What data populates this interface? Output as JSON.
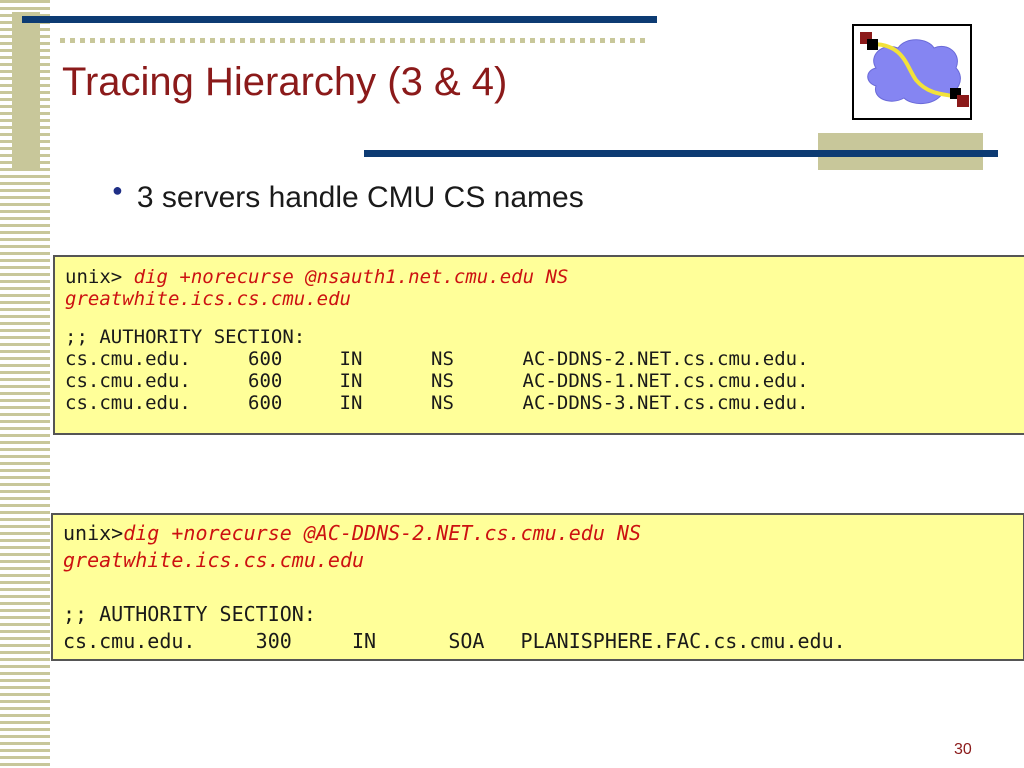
{
  "slide": {
    "title": "Tracing Hierarchy (3 & 4)",
    "bullet": "3 servers handle CMU CS names",
    "page_number": "30"
  },
  "box1": {
    "prompt": "unix> ",
    "command_line1": "dig +norecurse @nsauth1.net.cmu.edu NS",
    "command_line2": "greatwhite.ics.cs.cmu.edu",
    "section_header": ";; AUTHORITY SECTION:",
    "records": [
      "cs.cmu.edu.     600     IN      NS      AC-DDNS-2.NET.cs.cmu.edu.",
      "cs.cmu.edu.     600     IN      NS      AC-DDNS-1.NET.cs.cmu.edu.",
      "cs.cmu.edu.     600     IN      NS      AC-DDNS-3.NET.cs.cmu.edu."
    ]
  },
  "box2": {
    "prompt": "unix>",
    "command_line1": "dig +norecurse @AC-DDNS-2.NET.cs.cmu.edu NS",
    "command_line2": "greatwhite.ics.cs.cmu.edu",
    "section_header": ";; AUTHORITY SECTION:",
    "records": [
      "cs.cmu.edu.     300     IN      SOA   PLANISPHERE.FAC.cs.cmu.edu."
    ]
  },
  "colors": {
    "title": "#8b1a1a",
    "rule": "#0d3b73",
    "accent": "#c8c79a",
    "code_bg": "#ffff99",
    "command": "#cc1111"
  },
  "icons": {
    "logo": "network-cloud-logo-icon",
    "bullet": "bullet-dot-icon"
  }
}
